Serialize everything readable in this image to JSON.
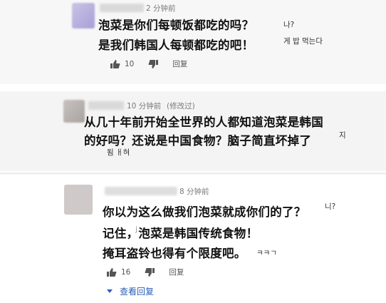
{
  "comments": [
    {
      "time": "2 分钟前",
      "edited": "",
      "line1": "泡菜是你们每顿饭都吃的吗？",
      "line2": "是我们韩国人每顿都吃的吧！",
      "ko_a": "나?",
      "ko_b": "게 밥 먹는다",
      "likes": "10",
      "reply_label": "回复"
    },
    {
      "time": "10 分钟前",
      "edited": "(修改过)",
      "line1": "从几十年前开始全世界的人都知道泡菜是韩国",
      "line2": "的好吗？还说是中国食物？脑子简直坏掉了",
      "ko_a": "지",
      "ko_b": "됨 ㅐ혀",
      "likes": "",
      "reply_label": ""
    },
    {
      "time": "8 分钟前",
      "edited": "",
      "line1": "你以为这么做我们泡菜就成你们的了？",
      "line2": "记住，泡菜是韩国传统食物！",
      "line3": "掩耳盗铃也得有个限度吧。",
      "ko_a": "니?",
      "ko_b": "ㅋㅋㄱ",
      "ko_c": "j",
      "likes": "16",
      "reply_label": "回复",
      "view_replies": "查看回复"
    }
  ],
  "colors": {
    "link": "#2b5fb8",
    "meta": "#7a7a7a"
  },
  "icons": [
    "thumb-up-icon",
    "thumb-down-icon",
    "caret-down-icon"
  ]
}
